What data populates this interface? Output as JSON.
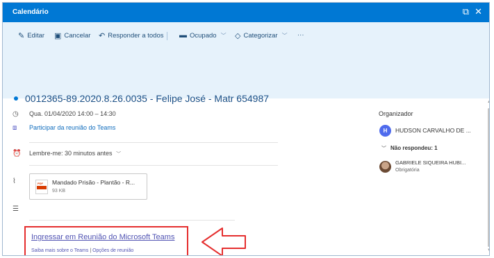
{
  "window": {
    "title": "Calendário"
  },
  "toolbar": {
    "edit": "Editar",
    "cancel": "Cancelar",
    "reply_all": "Responder a todos",
    "busy": "Ocupado",
    "categorize": "Categorizar",
    "more": "···"
  },
  "event": {
    "subject": "0012365-89.2020.8.26.0035 - Felipe José - Matr 654987",
    "datetime": "Qua. 01/04/2020 14:00 – 14:30",
    "teams_join_link": "Participar da reunião do Teams",
    "reminder": "Lembre-me: 30 minutos antes"
  },
  "attachment": {
    "name": "Mandado Prisão - Plantão - R...",
    "size": "93 KB"
  },
  "teams": {
    "join_text": "Ingressar em Reunião do Microsoft Teams",
    "learn_more": "Saiba mais sobre o Teams",
    "separator": "|",
    "meeting_options": "Opções de reunião"
  },
  "organizer": {
    "heading": "Organizador",
    "initial": "H",
    "name": "HUDSON CARVALHO DE ..."
  },
  "attendees": {
    "no_response_label": "Não respondeu: 1",
    "items": [
      {
        "name": "GABRIELE SIQUEIRA HUBI...",
        "role": "Obrigatória"
      }
    ]
  },
  "colors": {
    "titlebar": "#0078d4",
    "commandbar": "#e6f2fb",
    "highlight": "#e52d2d",
    "teams_link": "#4f52b2"
  }
}
